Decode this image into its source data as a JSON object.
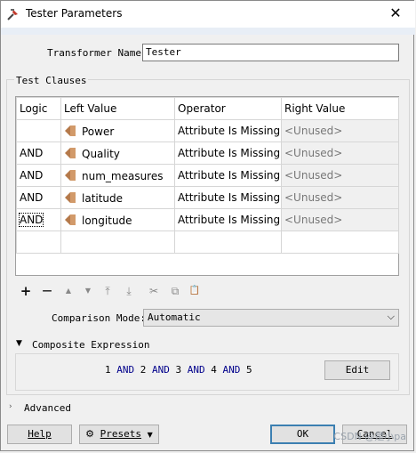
{
  "window": {
    "title": "Tester Parameters",
    "icon": "fme-tester-icon",
    "close_glyph": "✕"
  },
  "transformer_name": {
    "label": "Transformer Name:",
    "value": "Tester"
  },
  "test_clauses": {
    "group_label": "Test Clauses",
    "headers": [
      "Logic",
      "Left Value",
      "Operator",
      "Right Value"
    ],
    "rows": [
      {
        "logic": "",
        "left": "Power",
        "operator": "Attribute Is Missing",
        "right": "<Unused>"
      },
      {
        "logic": "AND",
        "left": "Quality",
        "operator": "Attribute Is Missing",
        "right": "<Unused>"
      },
      {
        "logic": "AND",
        "left": "num_measures",
        "operator": "Attribute Is Missing",
        "right": "<Unused>"
      },
      {
        "logic": "AND",
        "left": "latitude",
        "operator": "Attribute Is Missing",
        "right": "<Unused>"
      },
      {
        "logic": "AND",
        "left": "longitude",
        "operator": "Attribute Is Missing",
        "right": "<Unused>"
      }
    ]
  },
  "toolbar": {
    "add": "+",
    "remove": "—",
    "move_up": "▲",
    "move_down": "▼",
    "move_top": "⤒",
    "move_bottom": "⤓",
    "cut": "✂",
    "copy": "⧉",
    "paste": "📋"
  },
  "comparison_mode": {
    "label": "Comparison Mode:",
    "value": "Automatic"
  },
  "composite_expression": {
    "label": "Composite Expression",
    "parts": [
      "1",
      "AND",
      "2",
      "AND",
      "3",
      "AND",
      "4",
      "AND",
      "5"
    ],
    "edit_label": "Edit"
  },
  "advanced": {
    "label": "Advanced"
  },
  "footer": {
    "help": "Help",
    "presets": "Presets",
    "ok": "OK",
    "cancel": "Cancel"
  },
  "watermark": "CSDN @是小pa"
}
